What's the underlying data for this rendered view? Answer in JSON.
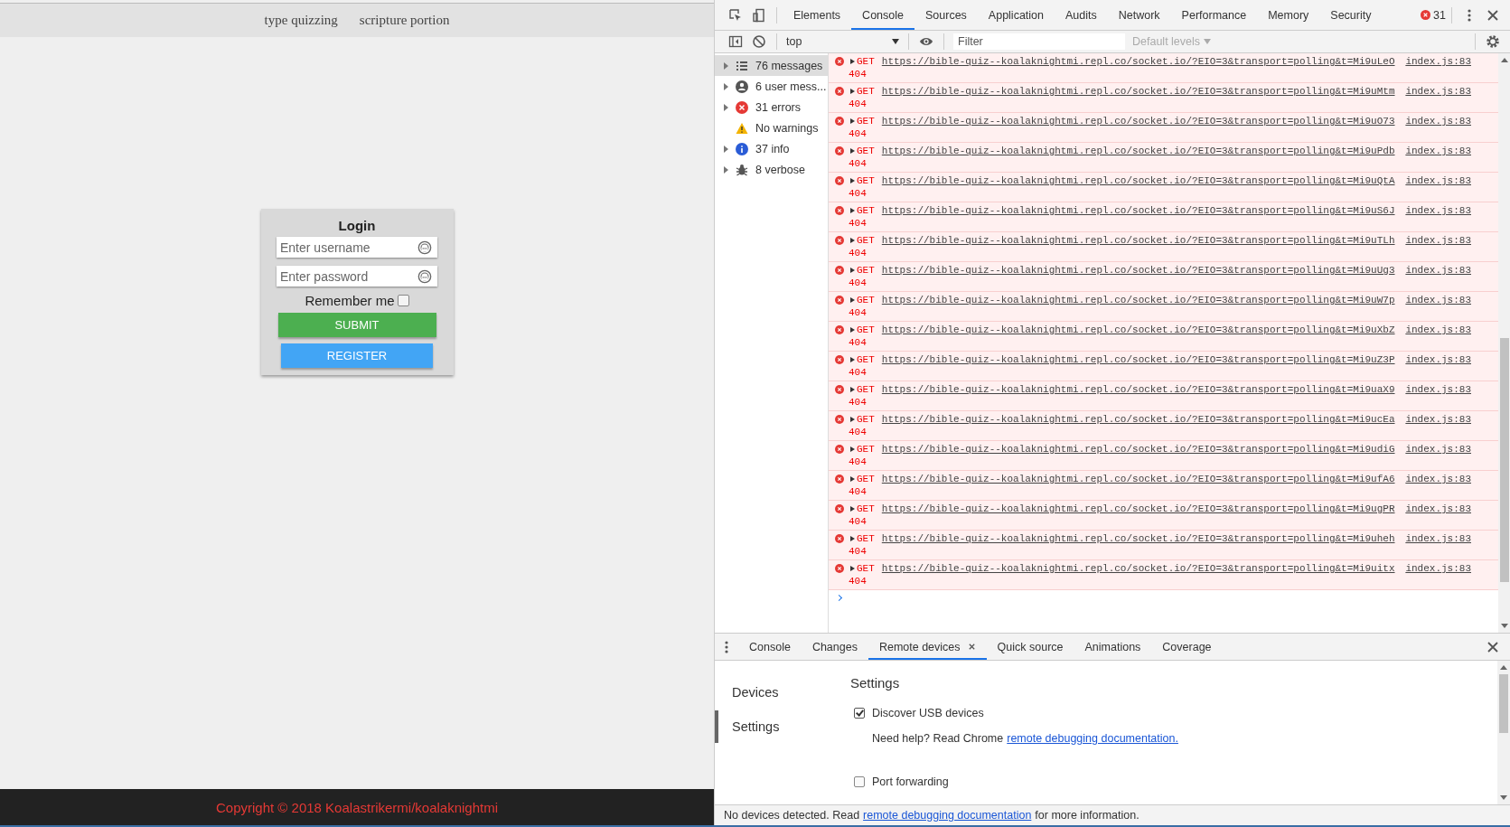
{
  "page": {
    "nav_links": [
      "type quizzing",
      "scripture portion"
    ],
    "login": {
      "title": "Login",
      "username_placeholder": "Enter username",
      "password_placeholder": "Enter password",
      "remember_label": "Remember me",
      "remember_checked": false,
      "submit": "SUBMIT",
      "register": "REGISTER"
    },
    "footer": "Copyright © 2018 Koalastrikermi/koalaknightmi"
  },
  "devtools": {
    "tabs": [
      {
        "label": "Elements",
        "selected": false
      },
      {
        "label": "Console",
        "selected": true
      },
      {
        "label": "Sources",
        "selected": false
      },
      {
        "label": "Application",
        "selected": false
      },
      {
        "label": "Audits",
        "selected": false
      },
      {
        "label": "Network",
        "selected": false
      },
      {
        "label": "Performance",
        "selected": false
      },
      {
        "label": "Memory",
        "selected": false
      },
      {
        "label": "Security",
        "selected": false
      }
    ],
    "error_count": "31",
    "toolbar": {
      "context": "top",
      "filter_placeholder": "Filter",
      "levels": "Default levels"
    },
    "sidebar": [
      {
        "label": "76 messages",
        "kind": "list",
        "selected": true,
        "expandable": true
      },
      {
        "label": "6 user mess...",
        "kind": "user",
        "selected": false,
        "expandable": true
      },
      {
        "label": "31 errors",
        "kind": "error",
        "selected": false,
        "expandable": true
      },
      {
        "label": "No warnings",
        "kind": "warning",
        "selected": false,
        "expandable": false
      },
      {
        "label": "37 info",
        "kind": "info",
        "selected": false,
        "expandable": true
      },
      {
        "label": "8 verbose",
        "kind": "verbose",
        "selected": false,
        "expandable": true
      }
    ],
    "messages": [
      {
        "method": "GET",
        "url": "https://bible-quiz--koalaknightmi.repl.co/socket.io/?EIO=3&transport=polling&t=Mi9uLeO",
        "status": "404",
        "source": "index.js:83"
      },
      {
        "method": "GET",
        "url": "https://bible-quiz--koalaknightmi.repl.co/socket.io/?EIO=3&transport=polling&t=Mi9uMtm",
        "status": "404",
        "source": "index.js:83"
      },
      {
        "method": "GET",
        "url": "https://bible-quiz--koalaknightmi.repl.co/socket.io/?EIO=3&transport=polling&t=Mi9uO73",
        "status": "404",
        "source": "index.js:83"
      },
      {
        "method": "GET",
        "url": "https://bible-quiz--koalaknightmi.repl.co/socket.io/?EIO=3&transport=polling&t=Mi9uPdb",
        "status": "404",
        "source": "index.js:83"
      },
      {
        "method": "GET",
        "url": "https://bible-quiz--koalaknightmi.repl.co/socket.io/?EIO=3&transport=polling&t=Mi9uQtA",
        "status": "404",
        "source": "index.js:83"
      },
      {
        "method": "GET",
        "url": "https://bible-quiz--koalaknightmi.repl.co/socket.io/?EIO=3&transport=polling&t=Mi9uS6J",
        "status": "404",
        "source": "index.js:83"
      },
      {
        "method": "GET",
        "url": "https://bible-quiz--koalaknightmi.repl.co/socket.io/?EIO=3&transport=polling&t=Mi9uTLh",
        "status": "404",
        "source": "index.js:83"
      },
      {
        "method": "GET",
        "url": "https://bible-quiz--koalaknightmi.repl.co/socket.io/?EIO=3&transport=polling&t=Mi9uUg3",
        "status": "404",
        "source": "index.js:83"
      },
      {
        "method": "GET",
        "url": "https://bible-quiz--koalaknightmi.repl.co/socket.io/?EIO=3&transport=polling&t=Mi9uW7p",
        "status": "404",
        "source": "index.js:83"
      },
      {
        "method": "GET",
        "url": "https://bible-quiz--koalaknightmi.repl.co/socket.io/?EIO=3&transport=polling&t=Mi9uXbZ",
        "status": "404",
        "source": "index.js:83"
      },
      {
        "method": "GET",
        "url": "https://bible-quiz--koalaknightmi.repl.co/socket.io/?EIO=3&transport=polling&t=Mi9uZ3P",
        "status": "404",
        "source": "index.js:83"
      },
      {
        "method": "GET",
        "url": "https://bible-quiz--koalaknightmi.repl.co/socket.io/?EIO=3&transport=polling&t=Mi9uaX9",
        "status": "404",
        "source": "index.js:83"
      },
      {
        "method": "GET",
        "url": "https://bible-quiz--koalaknightmi.repl.co/socket.io/?EIO=3&transport=polling&t=Mi9ucEa",
        "status": "404",
        "source": "index.js:83"
      },
      {
        "method": "GET",
        "url": "https://bible-quiz--koalaknightmi.repl.co/socket.io/?EIO=3&transport=polling&t=Mi9udiG",
        "status": "404",
        "source": "index.js:83"
      },
      {
        "method": "GET",
        "url": "https://bible-quiz--koalaknightmi.repl.co/socket.io/?EIO=3&transport=polling&t=Mi9ufA6",
        "status": "404",
        "source": "index.js:83"
      },
      {
        "method": "GET",
        "url": "https://bible-quiz--koalaknightmi.repl.co/socket.io/?EIO=3&transport=polling&t=Mi9ugPR",
        "status": "404",
        "source": "index.js:83"
      },
      {
        "method": "GET",
        "url": "https://bible-quiz--koalaknightmi.repl.co/socket.io/?EIO=3&transport=polling&t=Mi9uheh",
        "status": "404",
        "source": "index.js:83"
      },
      {
        "method": "GET",
        "url": "https://bible-quiz--koalaknightmi.repl.co/socket.io/?EIO=3&transport=polling&t=Mi9uitx",
        "status": "404",
        "source": "index.js:83"
      }
    ],
    "drawer": {
      "tabs": [
        {
          "label": "Console",
          "selected": false,
          "closable": false
        },
        {
          "label": "Changes",
          "selected": false,
          "closable": false
        },
        {
          "label": "Remote devices",
          "selected": true,
          "closable": true
        },
        {
          "label": "Quick source",
          "selected": false,
          "closable": false
        },
        {
          "label": "Animations",
          "selected": false,
          "closable": false
        },
        {
          "label": "Coverage",
          "selected": false,
          "closable": false
        }
      ],
      "nav": [
        {
          "label": "Devices",
          "selected": false
        },
        {
          "label": "Settings",
          "selected": true
        }
      ],
      "heading": "Settings",
      "discover": {
        "label": "Discover USB devices",
        "checked": true
      },
      "help_text": "Need help? Read Chrome",
      "help_link": "remote debugging documentation.",
      "port_forwarding": {
        "label": "Port forwarding",
        "checked": false
      },
      "status_text": "No devices detected. Read",
      "status_link": "remote debugging documentation",
      "status_suffix": "for more information."
    }
  }
}
